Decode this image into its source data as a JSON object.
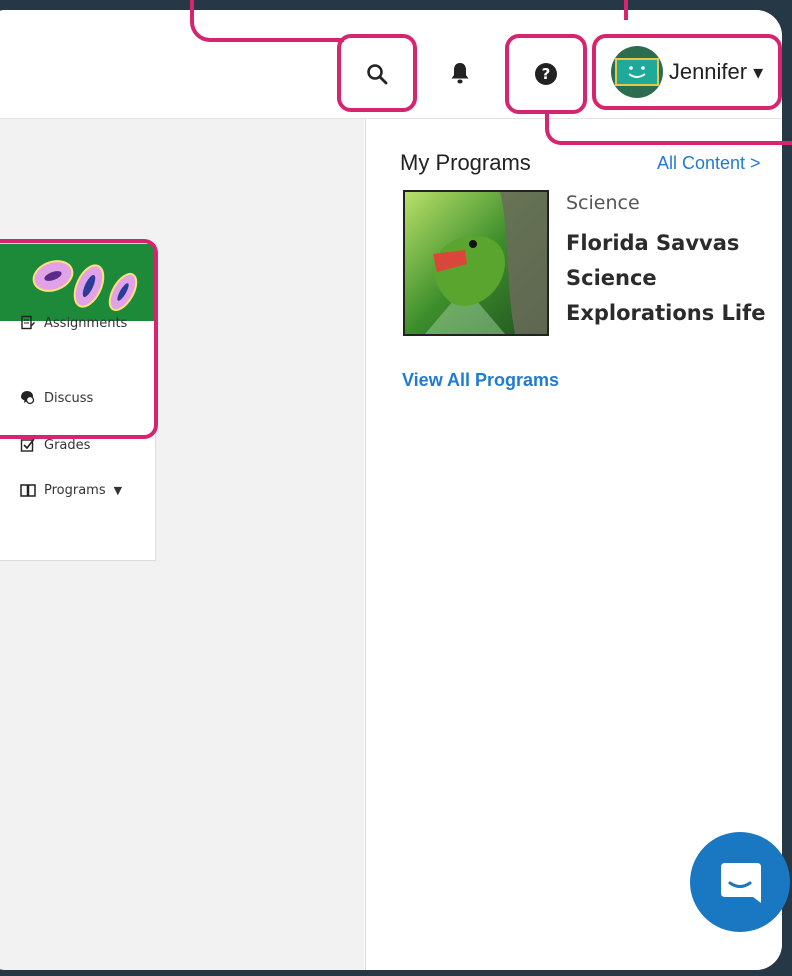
{
  "header": {
    "search_icon": "search-icon",
    "bell_icon": "bell-icon",
    "help_icon": "help-icon",
    "user": {
      "name": "Jennifer",
      "caret": "▾"
    }
  },
  "class_card": {
    "links": [
      {
        "label": "Assignments",
        "icon": "assignments-icon"
      },
      {
        "label": "Discuss",
        "icon": "discuss-icon"
      },
      {
        "label": "Grades",
        "icon": "grades-icon"
      },
      {
        "label": "Programs",
        "icon": "programs-icon",
        "caret": "▼"
      }
    ]
  },
  "programs": {
    "title": "My Programs",
    "all_content": "All Content >",
    "items": [
      {
        "subject": "Science",
        "title": "Florida Savvas Science Explorations Life"
      }
    ],
    "view_all": "View All Programs"
  },
  "colors": {
    "highlight": "#d6246e",
    "link": "#1f7bd4",
    "chat": "#1a78c2",
    "banner": "#1d8a3a"
  }
}
